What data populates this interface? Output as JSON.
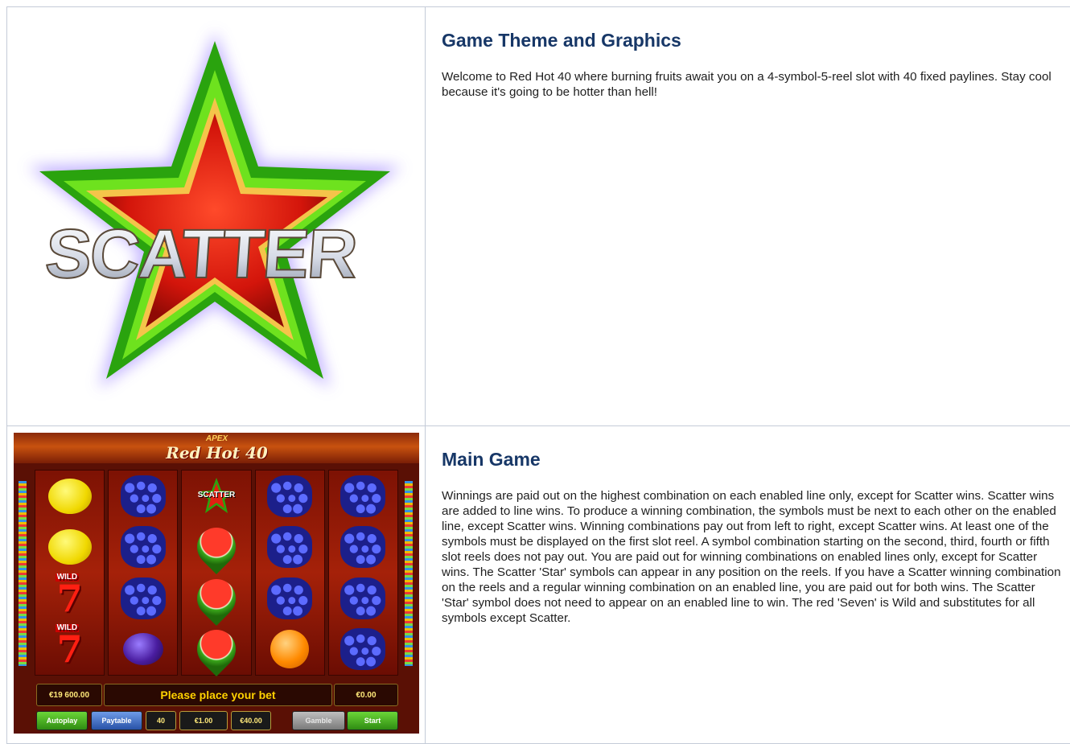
{
  "sections": [
    {
      "heading": "Game Theme and Graphics",
      "body": "Welcome to Red Hot 40 where burning fruits await you on a 4-symbol-5-reel slot with 40 fixed paylines. Stay cool because it's going to be hotter than hell!",
      "image": {
        "label": "SCATTER",
        "colors": {
          "outer": "#2aa30e",
          "inner": "#e02012",
          "gold": "#f5c44a",
          "glow": "#b9a8ff"
        }
      }
    },
    {
      "heading": "Main Game",
      "body": "Winnings are paid out on the highest combination on each enabled line only, except for Scatter wins. Scatter wins are added to line wins. To produce a winning combination, the symbols must be next to each other on the enabled line, except Scatter wins. Winning combinations pay out from left to right, except Scatter wins. At least one of the symbols must be displayed on the first slot reel. A symbol combination starting on the second, third, fourth or fifth slot reels does not pay out. You are paid out for winning combinations on enabled lines only, except for Scatter wins. The Scatter 'Star' symbols can appear in any position on the reels. If you have a Scatter winning combination on the reels and a regular winning combination on an enabled line, you are paid out for both wins. The Scatter 'Star' symbol does not need to appear on an enabled line to win. The red 'Seven' is Wild and substitutes for all symbols except Scatter.",
      "game": {
        "apex": "APEX",
        "title": "Red Hot 40",
        "scatter_label": "SCATTER",
        "wild_label": "WILD",
        "seven": "7",
        "credit": "€19 600.00",
        "message": "Please place your bet",
        "win": "€0.00",
        "lines": "40",
        "bet_per_line": "€1.00",
        "total_bet": "€40.00",
        "buttons": {
          "autoplay": "Autoplay",
          "paytable": "Paytable",
          "gamble": "Gamble",
          "start": "Start"
        }
      }
    }
  ]
}
